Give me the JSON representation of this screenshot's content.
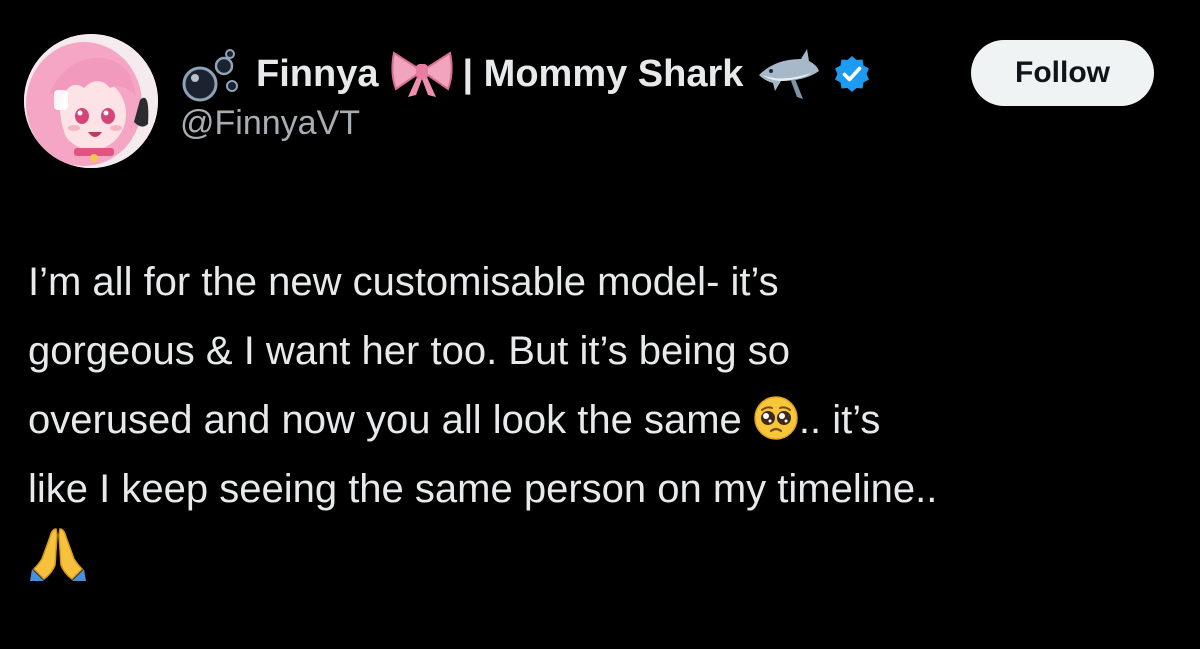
{
  "author": {
    "display_name_part1": "Finnya",
    "display_name_part2": "| Mommy Shark",
    "handle": "@FinnyaVT",
    "verified": true,
    "icons": [
      "bubbles-icon",
      "ribbon-icon",
      "shark-icon",
      "verified-badge-icon"
    ]
  },
  "follow_button": {
    "label": "Follow"
  },
  "tweet": {
    "line1": "I’m all for the new customisable model- it’s",
    "line2": "gorgeous & I want her too. But it’s being so",
    "line3a": "overused and now you all look the same",
    "line3b": ".. it’s",
    "line4": "like I keep seeing the same person on my timeline..",
    "emojis": [
      "pleading-face-icon",
      "folded-hands-icon"
    ]
  },
  "colors": {
    "background": "#000000",
    "text": "#e7e9ea",
    "secondary_text": "#a8adb3",
    "button_bg": "#eff3f4",
    "verified_blue": "#1d9bf0"
  }
}
